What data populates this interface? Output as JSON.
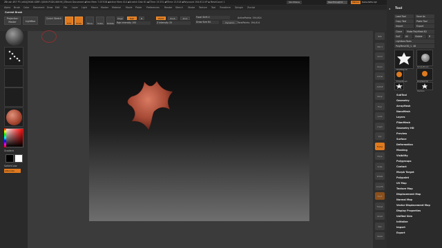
{
  "titlebar": {
    "text": "ZBrush 4R7 P3 (x64)[5648-SDRF-QGNH-PGDS-WKHH]  ZBrush Document   ▪Free Mem 7.037GB ▪Active Mem 414 ▪Scratch Disk 61 ▪ZTime 13.531 ▪RTime 13.516 ▪Polycount 194.611 KP ▪ MeshCount 1",
    "quicksave": "QuickSave",
    "seethrough": "See-through  0",
    "menus": "Menus",
    "default_script": "DefaultZScript",
    "window_icons": "◐ ─ ▢ ✕"
  },
  "menubar": [
    "Alpha",
    "Brush",
    "Color",
    "Document",
    "Draw",
    "Edit",
    "File",
    "Layer",
    "Light",
    "Macro",
    "Marker",
    "Material",
    "Movie",
    "Picker",
    "Preferences",
    "Render",
    "Stencil",
    "Stroke",
    "Texture",
    "Tool",
    "Transform",
    "Zplugin",
    "Zscript"
  ],
  "toolbar": {
    "current_brush": "Current Brush",
    "projection_master": "Projection Master",
    "lightbox": "LightBox",
    "quick_sketch": "Quick Sketch",
    "edit": "Edit",
    "draw": "Draw",
    "move": "Move",
    "scale": "Scale",
    "rotate": "Rotate",
    "mrgb": "Mrgb",
    "rgb": "Rgb",
    "m": "M",
    "rgb_intensity": "Rgb Intensity 100",
    "zadd": "Zadd",
    "zsub": "Zsub",
    "zcut": "Zcut",
    "z_intensity": "Z Intensity 25",
    "focal_shift": "Focal Shift 0",
    "draw_size": "Draw Size 64",
    "dynamic": "Dynamic",
    "active_points": "ActivePoints: 194,614",
    "total_points": "TotalPoints: 194,614"
  },
  "leftshelf": {
    "gradient": "Gradient",
    "switch_color": "SwitchColor",
    "alternate": "Alternate"
  },
  "rightshelf": [
    "BPR",
    "SPix 3",
    "Scroll",
    "Zoom",
    "Actual",
    "AAHalf",
    "Persp",
    "Floor",
    "Local",
    "L.Sym",
    "Xyz",
    "Frame",
    "Move",
    "Scale",
    "Rotate",
    "Line Fill",
    "PolyF",
    "Transp",
    "Ghost",
    "Solo",
    "Xpose"
  ],
  "toolpanel": {
    "title": "Tool",
    "load_tool": "Load Tool",
    "save_as": "Save As",
    "copy_tool": "Copy Tool",
    "paste_tool": "Paste Tool",
    "import": "Import",
    "export": "Export",
    "clone": "Clone",
    "make_polymesh": "Make PolyMesh3D",
    "goz": "GoZ",
    "all": "All",
    "visible": "Visible",
    "r": "R",
    "lightbox_tools": "Lightbox›Tools",
    "current_tool": "PolyMesh3D_1. 48",
    "thumbs": [
      "PolyMesh3D",
      "SimpleBrush",
      "EraserBrush",
      "PolyMesh3D",
      "Zsphere"
    ],
    "subpalettes": [
      "SubTool",
      "Geometry",
      "ArrayMesh",
      "NanoMesh",
      "Layers",
      "FiberMesh",
      "Geometry HD",
      "Preview",
      "Surface",
      "Deformation",
      "Masking",
      "Visibility",
      "Polygroups",
      "Contact",
      "Morph Target",
      "Polypaint",
      "UV Map",
      "Texture Map",
      "Displacement Map",
      "Normal Map",
      "Vector Displacement Map",
      "Display Properties",
      "Unified Skin",
      "Initialize",
      "Import",
      "Export"
    ]
  },
  "colors": {
    "accent": "#e07a1e",
    "star": "#b8553f",
    "background": "#2b2b2b"
  }
}
